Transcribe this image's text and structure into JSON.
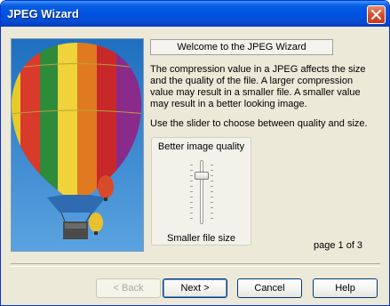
{
  "window": {
    "title": "JPEG Wizard"
  },
  "header": {
    "welcome": "Welcome to the JPEG Wizard"
  },
  "content": {
    "paragraph1": "The compression value in a JPEG affects the size and the quality of the file. A larger compression value may result in a smaller file. A smaller value may result in a better looking image.",
    "paragraph2": "Use the slider to choose between quality and size."
  },
  "slider": {
    "top_label": "Better image quality",
    "bottom_label": "Smaller file size",
    "level": 0.2
  },
  "pager": {
    "text": "page 1 of 3"
  },
  "buttons": {
    "back": "< Back",
    "next": "Next >",
    "cancel": "Cancel",
    "help": "Help"
  },
  "colors": {
    "titlebar": "#0054e3",
    "close": "#d6502a",
    "face": "#ece9d8"
  },
  "icons": {
    "close": "close-icon",
    "illustration": "hot-air-balloon-image"
  }
}
